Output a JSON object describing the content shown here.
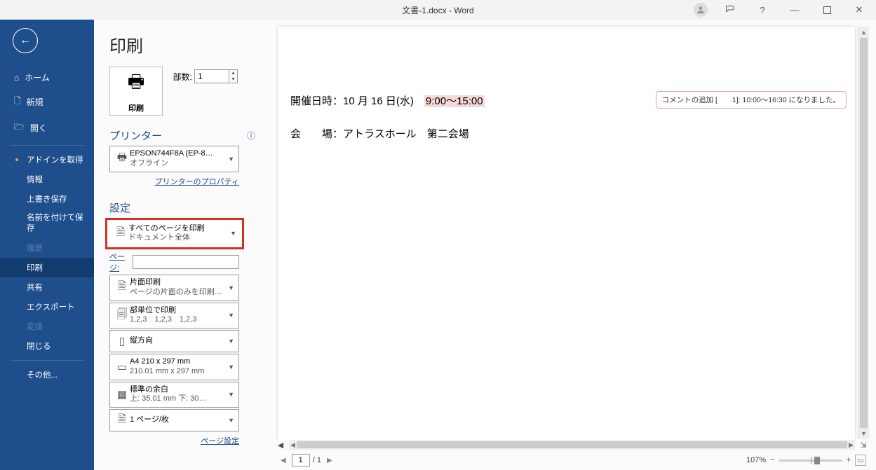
{
  "titlebar": {
    "title": "文書-1.docx - Word"
  },
  "sidebar": {
    "items": [
      {
        "label": "ホーム"
      },
      {
        "label": "新規"
      },
      {
        "label": "開く"
      },
      {
        "label": "アドインを取得"
      },
      {
        "label": "情報"
      },
      {
        "label": "上書き保存"
      },
      {
        "label": "名前を付けて保存"
      },
      {
        "label": "履歴"
      },
      {
        "label": "印刷"
      },
      {
        "label": "共有"
      },
      {
        "label": "エクスポート"
      },
      {
        "label": "変換"
      },
      {
        "label": "閉じる"
      },
      {
        "label": "その他..."
      }
    ]
  },
  "print": {
    "heading": "印刷",
    "print_button": "印刷",
    "copies_label": "部数:",
    "copies_value": "1",
    "printer_section": "プリンター",
    "printer_name": "EPSON744F8A (EP-8…",
    "printer_status": "オフライン",
    "printer_props": "プリンターのプロパティ",
    "settings_section": "設定",
    "all_pages_l1": "すべてのページを印刷",
    "all_pages_l2": "ドキュメント全体",
    "pages_label": "ページ:",
    "pages_value": "",
    "oneside_l1": "片面印刷",
    "oneside_l2": "ページの片面のみを印刷し…",
    "collate_l1": "部単位で印刷",
    "collate_l2": "1,2,3　1,2,3　1,2,3",
    "orient_l1": "縦方向",
    "paper_l1": "A4 210 x 297 mm",
    "paper_l2": "210.01 mm x 297 mm",
    "margin_l1": "標準の余白",
    "margin_l2": "上: 35.01 mm 下: 30…",
    "pps_l1": "1 ページ/枚",
    "page_setup": "ページ設定"
  },
  "document": {
    "line1_label": "開催日時：",
    "line1_date": "10 月 16 日(水)　",
    "line1_time": "9:00～15:00",
    "line2": "会　　場：アトラスホール　第二会場",
    "comment_label": "コメントの追加 [　　1]: ",
    "comment_text": "10:00～16:30 になりました。"
  },
  "footer": {
    "current_page": "1",
    "total_pages": "/ 1",
    "zoom": "107%"
  }
}
